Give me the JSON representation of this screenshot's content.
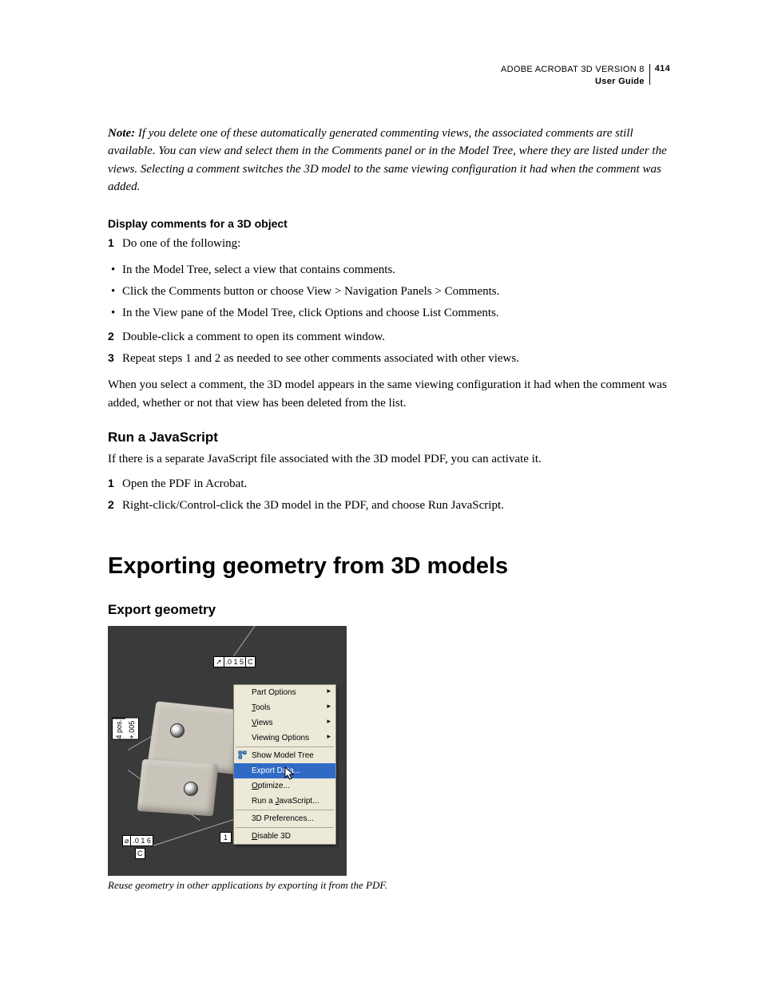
{
  "header": {
    "line1": "ADOBE ACROBAT 3D VERSION 8",
    "line2": "User Guide",
    "pagenum": "414"
  },
  "note": {
    "label": "Note:",
    "text": " If you delete one of these automatically generated commenting views, the associated comments are still available. You can view and select them in the Comments panel or in the Model Tree, where they are listed under the views. Selecting a comment switches the 3D model to the same viewing configuration it had when the comment was added."
  },
  "section1": {
    "title": "Display comments for a 3D object",
    "step1": "Do one of the following:",
    "bullets": [
      "In the Model Tree, select a view that contains comments.",
      "Click the Comments button or choose View > Navigation Panels > Comments.",
      "In the View pane of the Model Tree, click Options and choose List Comments."
    ],
    "step2": "Double-click a comment to open its comment window.",
    "step3": "Repeat steps 1 and 2 as needed to see other comments associated with other views.",
    "after": "When you select a comment, the 3D model appears in the same viewing configuration it had when the comment was added, whether or not that view has been deleted from the list."
  },
  "section2": {
    "title": "Run a JavaScript",
    "intro": "If there is a separate JavaScript file associated with the 3D model PDF, you can activate it.",
    "step1": "Open the PDF in Acrobat.",
    "step2": "Right-click/Control-click the 3D model in the PDF, and choose Run JavaScript."
  },
  "h1": "Exporting geometry from 3D models",
  "section3": {
    "title": "Export geometry"
  },
  "figure": {
    "top_label_cells": [
      "↗",
      ".0 1 5",
      "C"
    ],
    "bottom_label1_cells": [
      "⌀",
      ".0 1 6"
    ],
    "bottom_label2_cells": [
      "C"
    ],
    "side_label_cells": [
      "4 pos.",
      "+.005"
    ],
    "menu": {
      "items_top": [
        {
          "label": "Part Options",
          "arrow": true
        },
        {
          "label": "Tools",
          "arrow": true,
          "accel": "T"
        },
        {
          "label": "Views",
          "arrow": true,
          "accel": "V"
        },
        {
          "label": "Viewing Options",
          "arrow": true
        }
      ],
      "items_mid": [
        {
          "label": "Show Model Tree",
          "icon": true
        },
        {
          "label": "Export Data...",
          "highlight": true
        },
        {
          "label": "Optimize...",
          "accel": "O"
        },
        {
          "label": "Run a JavaScript...",
          "accel": "J"
        }
      ],
      "items_bot": [
        {
          "label": "3D Preferences..."
        }
      ],
      "items_last": [
        {
          "label": "Disable 3D",
          "accel": "D"
        }
      ]
    },
    "caption": "Reuse geometry in other applications by exporting it from the PDF."
  }
}
